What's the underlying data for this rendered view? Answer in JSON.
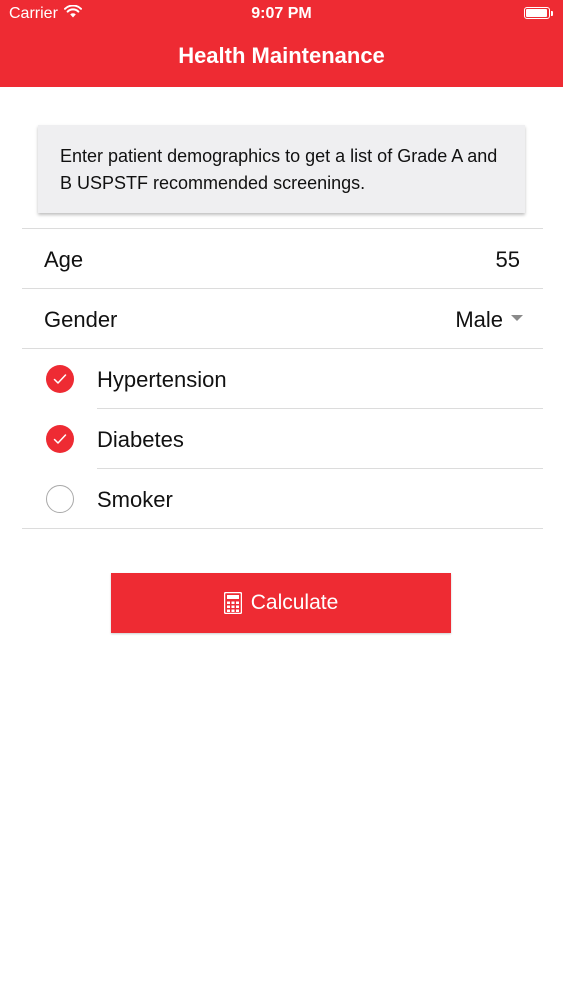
{
  "status_bar": {
    "carrier": "Carrier",
    "time": "9:07 PM"
  },
  "nav": {
    "title": "Health Maintenance"
  },
  "info": {
    "text": "Enter patient demographics to get a list of Grade A and B USPSTF recommended screenings."
  },
  "form": {
    "age_label": "Age",
    "age_value": "55",
    "gender_label": "Gender",
    "gender_value": "Male",
    "conditions": [
      {
        "label": "Hypertension",
        "checked": true
      },
      {
        "label": "Diabetes",
        "checked": true
      },
      {
        "label": "Smoker",
        "checked": false
      }
    ]
  },
  "button": {
    "icon": "calculator-icon",
    "label": "Calculate"
  },
  "colors": {
    "accent": "#ee2b33",
    "card_bg": "#efeff1",
    "divider": "#dcdcdc"
  }
}
